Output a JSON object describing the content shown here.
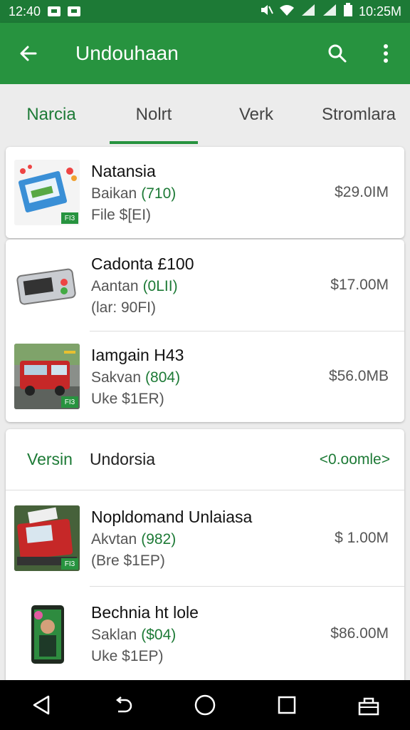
{
  "status_bar": {
    "time_left": "12:40",
    "time_right": "10:25M"
  },
  "app_bar": {
    "title": "Undouhaan"
  },
  "tabs": [
    {
      "label": "Narcia"
    },
    {
      "label": "Nolrt"
    },
    {
      "label": "Verk"
    },
    {
      "label": "Stromlara"
    }
  ],
  "card1": {
    "items": [
      {
        "name": "Natansia",
        "sub": "Baikan",
        "code": "(710)",
        "file": "File $[EI)",
        "size": "$29.0IM",
        "badge": "FI3"
      }
    ]
  },
  "card2": {
    "items": [
      {
        "name": "Cadonta £100",
        "sub": "Aantan",
        "code": "(0LII)",
        "file": "(lar: 90FI)",
        "size": "$17.00M"
      },
      {
        "name": "Iamgain H43",
        "sub": "Sakvan",
        "code": "(804)",
        "file": "Uke $1ER)",
        "size": "$56.0MB",
        "badge": "FI3"
      }
    ]
  },
  "section": {
    "label": "Versin",
    "title": "Undorsia",
    "more": "<0.oomle>",
    "items": [
      {
        "name": "Nopldomand Unlaiasa",
        "sub": "Akvtan",
        "code": "(982)",
        "file": "(Bre $1EP)",
        "size": "$ 1.00M",
        "badge": "FI3"
      },
      {
        "name": "Bechnia ht lole",
        "sub": "Saklan",
        "code": "($04)",
        "file": "Uke $1EP)",
        "size": "$86.00M"
      }
    ]
  },
  "colors": {
    "primary": "#27933f",
    "primary_dark": "#1d7a36",
    "accent_text": "#1d7a36"
  }
}
